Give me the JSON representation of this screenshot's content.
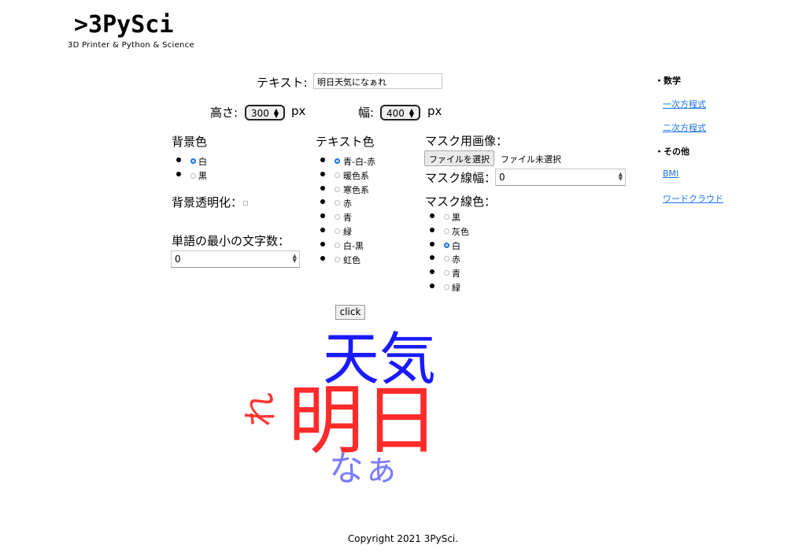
{
  "logo": {
    "main": ">3PySci",
    "sub": "3D Printer & Python & Science"
  },
  "form": {
    "text_label": "テキスト:",
    "text_value": "明日天気になぁれ",
    "height_label": "高さ:",
    "height_value": "300",
    "width_label": "幅:",
    "width_value": "400",
    "unit": "px",
    "bg_color": {
      "label": "背景色",
      "options": [
        "白",
        "黒"
      ],
      "selected": "白"
    },
    "bg_transparent_label": "背景透明化：",
    "min_chars": {
      "label": "単語の最小の文字数：",
      "value": "0"
    },
    "text_color": {
      "label": "テキスト色",
      "options": [
        "青-白-赤",
        "暖色系",
        "寒色系",
        "赤",
        "青",
        "緑",
        "白-黒",
        "虹色"
      ],
      "selected": "青-白-赤"
    },
    "mask_image": {
      "label": "マスク用画像：",
      "button": "ファイルを選択",
      "status": "ファイル未選択"
    },
    "mask_line_width": {
      "label": "マスク線幅：",
      "value": "0"
    },
    "mask_line_color": {
      "label": "マスク線色：",
      "options": [
        "黒",
        "灰色",
        "白",
        "赤",
        "青",
        "緑"
      ],
      "selected": "白"
    },
    "submit": "click"
  },
  "wordcloud": {
    "words": [
      {
        "text": "天気",
        "color": "#1a1aff"
      },
      {
        "text": "明日",
        "color": "#ff2b2b"
      },
      {
        "text": "れ",
        "color": "#ff3333"
      },
      {
        "text": "なぁ",
        "color": "#7b7bff"
      }
    ]
  },
  "sidebar": {
    "sections": [
      {
        "heading": "・数学",
        "links": [
          "一次方程式",
          "二次方程式"
        ]
      },
      {
        "heading": "・その他",
        "links": [
          "BMI",
          "ワードクラウド"
        ]
      }
    ]
  },
  "footer": {
    "copyright": "Copyright 2021 3PySci."
  }
}
